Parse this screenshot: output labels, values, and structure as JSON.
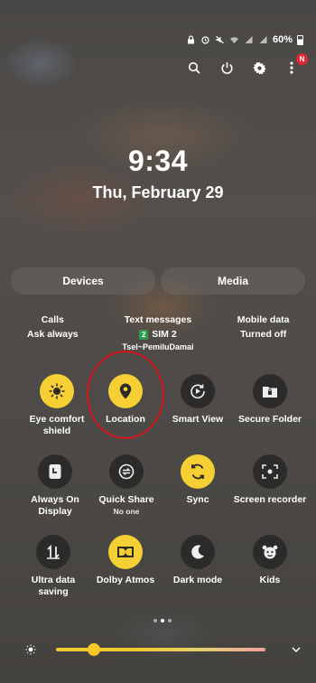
{
  "status_bar": {
    "battery": "60%"
  },
  "clock": {
    "time": "9:34",
    "date": "Thu, February 29"
  },
  "panels": {
    "devices": "Devices",
    "media": "Media"
  },
  "sim": {
    "calls": {
      "label": "Calls",
      "value": "Ask always"
    },
    "text_messages": {
      "label": "Text messages",
      "sim_number": "2",
      "value": "SIM 2",
      "carrier": "Tsel~PemiluDamai"
    },
    "mobile_data": {
      "label": "Mobile data",
      "value": "Turned off"
    }
  },
  "notifications": {
    "badge": "N"
  },
  "tiles": [
    {
      "label": "Eye comfort shield",
      "sub": "",
      "icon": "eye-comfort-icon",
      "on": true
    },
    {
      "label": "Location",
      "sub": "",
      "icon": "location-pin-icon",
      "on": true
    },
    {
      "label": "Smart View",
      "sub": "",
      "icon": "smart-view-icon",
      "on": false
    },
    {
      "label": "Secure Folder",
      "sub": "",
      "icon": "secure-folder-icon",
      "on": false
    },
    {
      "label": "Always On Display",
      "sub": "",
      "icon": "always-on-display-icon",
      "on": false
    },
    {
      "label": "Quick Share",
      "sub": "No one",
      "icon": "quick-share-icon",
      "on": false
    },
    {
      "label": "Sync",
      "sub": "",
      "icon": "sync-icon",
      "on": true
    },
    {
      "label": "Screen recorder",
      "sub": "",
      "icon": "screen-recorder-icon",
      "on": false
    },
    {
      "label": "Ultra data saving",
      "sub": "",
      "icon": "ultra-data-saving-icon",
      "on": false
    },
    {
      "label": "Dolby Atmos",
      "sub": "",
      "icon": "dolby-atmos-icon",
      "on": true
    },
    {
      "label": "Dark mode",
      "sub": "",
      "icon": "dark-mode-icon",
      "on": false
    },
    {
      "label": "Kids",
      "sub": "",
      "icon": "kids-icon",
      "on": false
    }
  ],
  "pager": {
    "pages": 3,
    "active": 1
  },
  "brightness": {
    "level": 0.18
  },
  "colors": {
    "accent": "#f6cf34",
    "highlight_ring": "#d5151c",
    "tile_off": "#2c2b2a"
  }
}
